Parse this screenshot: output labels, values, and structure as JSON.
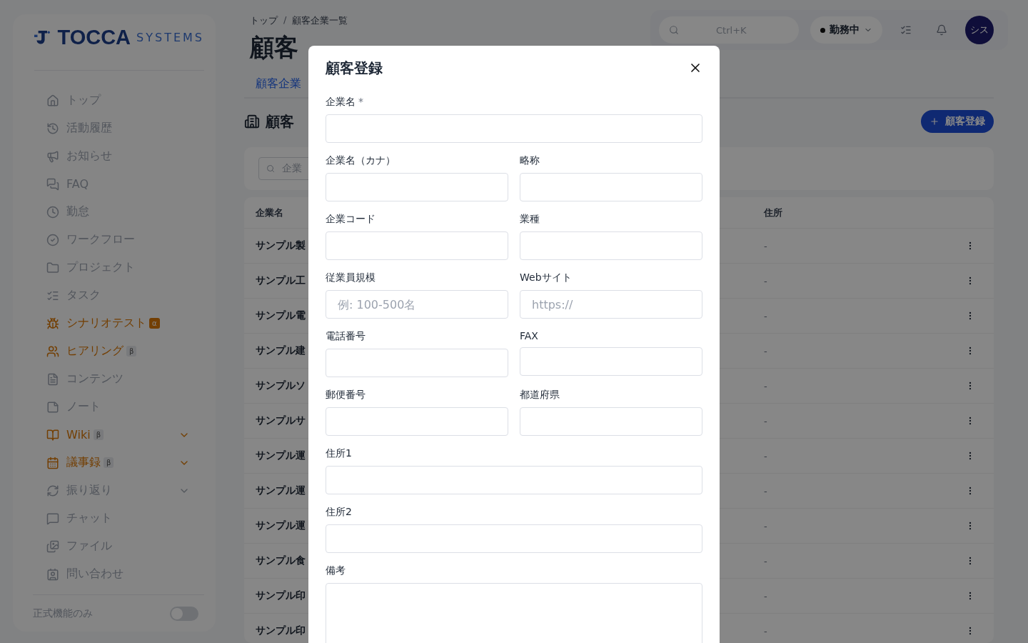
{
  "brand": {
    "name": "TOCCA",
    "suffix": "SYSTEMS"
  },
  "sidebar": {
    "items": [
      {
        "label": "トップ",
        "highlight": false,
        "expandable": false
      },
      {
        "label": "活動履歴",
        "highlight": false,
        "expandable": false
      },
      {
        "label": "お知らせ",
        "highlight": false,
        "expandable": false
      },
      {
        "label": "FAQ",
        "highlight": false,
        "expandable": false
      },
      {
        "label": "勤怠",
        "highlight": false,
        "expandable": false
      },
      {
        "label": "ワークフロー",
        "highlight": false,
        "expandable": false
      },
      {
        "label": "プロジェクト",
        "highlight": false,
        "expandable": false
      },
      {
        "label": "タスク",
        "highlight": false,
        "expandable": false
      },
      {
        "label": "シナリオテスト",
        "highlight": true,
        "badge": "α",
        "expandable": false
      },
      {
        "label": "ヒアリング",
        "highlight": true,
        "badge": "β",
        "expandable": false
      },
      {
        "label": "コンテンツ",
        "highlight": false,
        "expandable": false
      },
      {
        "label": "ノート",
        "highlight": false,
        "expandable": false
      },
      {
        "label": "Wiki",
        "highlight": true,
        "badge": "β",
        "expandable": true
      },
      {
        "label": "議事録",
        "highlight": true,
        "badge": "β",
        "expandable": true
      },
      {
        "label": "振り返り",
        "highlight": false,
        "expandable": true
      },
      {
        "label": "チャット",
        "highlight": false,
        "expandable": false
      },
      {
        "label": "ファイル",
        "highlight": false,
        "expandable": false
      },
      {
        "label": "問い合わせ",
        "highlight": false,
        "expandable": false
      }
    ],
    "footer": {
      "label": "正式機能のみ",
      "on": false
    }
  },
  "breadcrumb": [
    {
      "kind": "link",
      "text": "トップ"
    },
    {
      "kind": "separator",
      "text": "/"
    },
    {
      "kind": "link",
      "text": "顧客企業一覧"
    }
  ],
  "page_title": "顧客",
  "topbar": {
    "search_shortcut": "Ctrl+K",
    "status": "勤務中",
    "avatar": "シス"
  },
  "tab": "顧客企業",
  "section_title": "顧客",
  "add_button": "顧客登録",
  "filter": {
    "placeholder": "企業"
  },
  "table": {
    "columns": [
      "企業名",
      "住所"
    ],
    "rows": [
      {
        "name": "サンプル製",
        "address": "-"
      },
      {
        "name": "サンプル工",
        "address": "-"
      },
      {
        "name": "サンプル電",
        "address": "-"
      },
      {
        "name": "サンプル建",
        "address": "-"
      },
      {
        "name": "サンプルソ",
        "address": "-"
      },
      {
        "name": "サンプルサ",
        "address": "-"
      },
      {
        "name": "サンプル運",
        "address": "-"
      },
      {
        "name": "サンプル運",
        "address": "-"
      },
      {
        "name": "サンプル運",
        "address": "-"
      },
      {
        "name": "サンプル食",
        "address": "-"
      },
      {
        "name": "サンプル印",
        "address": "-"
      },
      {
        "name": "サンプル印",
        "address": "-"
      }
    ]
  },
  "dialog": {
    "title": "顧客登録",
    "fields": [
      {
        "label": "企業名",
        "required_mark": "*",
        "wide": true,
        "kind": "input"
      },
      {
        "label": "企業名（カナ）",
        "wide": false,
        "kind": "input"
      },
      {
        "label": "略称",
        "wide": false,
        "kind": "input"
      },
      {
        "label": "企業コード",
        "wide": false,
        "kind": "input"
      },
      {
        "label": "業種",
        "wide": false,
        "kind": "input"
      },
      {
        "label": "従業員規模",
        "wide": false,
        "kind": "input",
        "placeholder": "例: 100-500名"
      },
      {
        "label": "Webサイト",
        "wide": false,
        "kind": "input",
        "placeholder": "https://"
      },
      {
        "label": "電話番号",
        "wide": false,
        "kind": "input"
      },
      {
        "label": "FAX",
        "wide": false,
        "kind": "input"
      },
      {
        "label": "郵便番号",
        "wide": false,
        "kind": "input"
      },
      {
        "label": "都道府県",
        "wide": false,
        "kind": "input"
      },
      {
        "label": "住所1",
        "wide": true,
        "kind": "input"
      },
      {
        "label": "住所2",
        "wide": true,
        "kind": "input"
      },
      {
        "label": "備考",
        "wide": true,
        "kind": "textarea"
      }
    ]
  }
}
